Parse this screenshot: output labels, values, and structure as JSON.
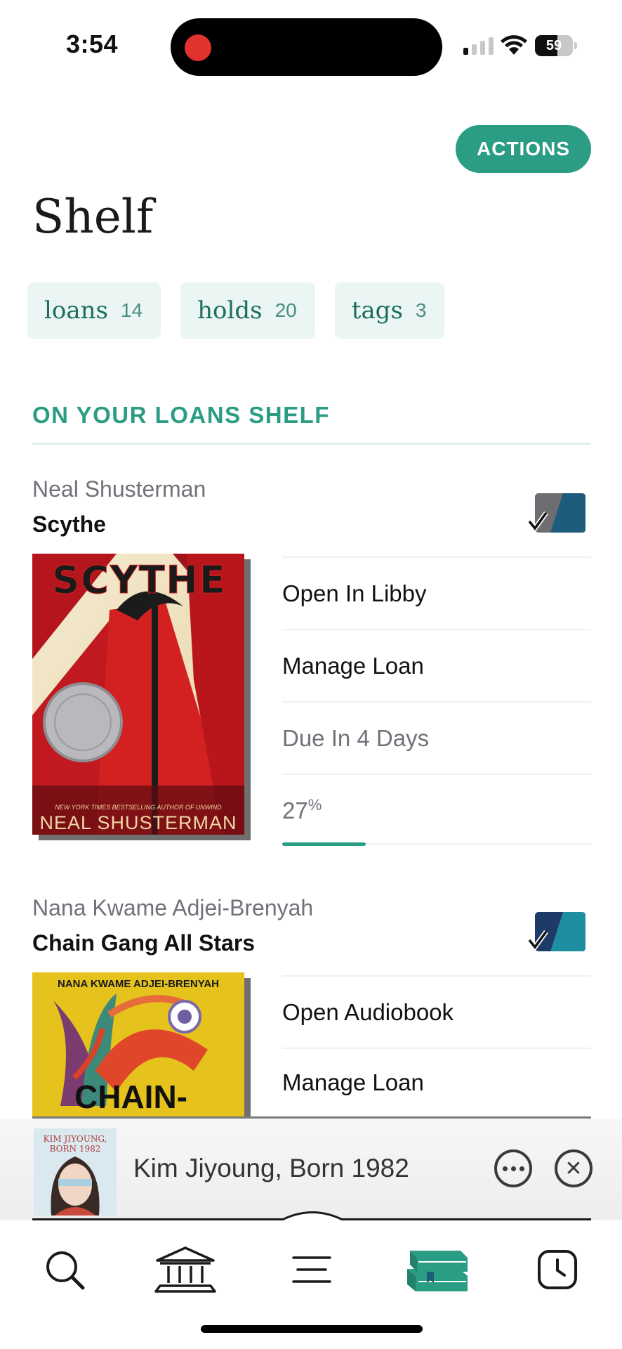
{
  "status_bar": {
    "time": "3:54",
    "battery_level": "59",
    "battery_fraction": 0.59,
    "signal_bars": 1
  },
  "header": {
    "actions_label": "ACTIONS",
    "title": "Shelf"
  },
  "chips": [
    {
      "label": "loans",
      "count": "14"
    },
    {
      "label": "holds",
      "count": "20"
    },
    {
      "label": "tags",
      "count": "3"
    }
  ],
  "section": {
    "heading": "ON YOUR LOANS SHELF"
  },
  "books": [
    {
      "author": "Neal Shusterman",
      "title": "Scythe",
      "format_icon": "ebook-badge-icon",
      "cover_title": "SCYTHE",
      "cover_tagline": "NEW YORK TIMES BESTSELLING AUTHOR OF UNWIND",
      "cover_author": "NEAL SHUSTERMAN",
      "actions": {
        "open": "Open In Libby",
        "manage": "Manage Loan",
        "due": "Due In 4 Days"
      },
      "progress_value": "27",
      "progress_unit": "%",
      "progress_fraction": 0.27
    },
    {
      "author": "Nana Kwame Adjei-Brenyah",
      "title": "Chain Gang All Stars",
      "format_icon": "audiobook-badge-icon",
      "cover_author": "NANA KWAME ADJEI-BRENYAH",
      "cover_title": "CHAIN-",
      "actions": {
        "open": "Open Audiobook",
        "manage": "Manage Loan"
      }
    }
  ],
  "mini_player": {
    "title": "Kim Jiyoung, Born 1982",
    "cover_text": "KIM JIYOUNG, BORN 1982",
    "more_icon": "more-icon",
    "close_icon": "close-icon"
  },
  "tab_bar": {
    "items": [
      {
        "name": "search-icon"
      },
      {
        "name": "library-icon"
      },
      {
        "name": "menu-icon"
      },
      {
        "name": "shelf-icon",
        "active": true
      },
      {
        "name": "timeline-icon"
      }
    ]
  },
  "colors": {
    "accent": "#2a9d84",
    "chip_bg": "#eaf5f4",
    "chip_text": "#1c6e5e"
  }
}
